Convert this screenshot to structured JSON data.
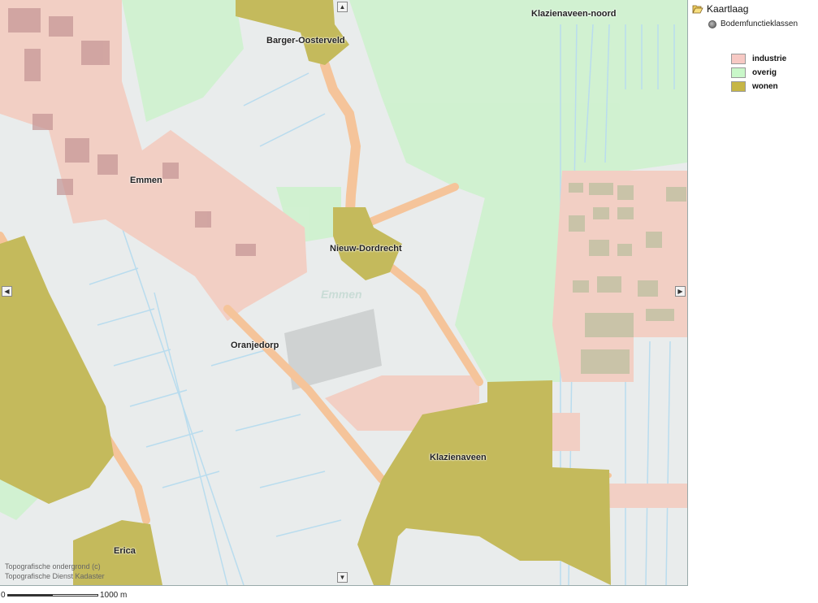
{
  "map": {
    "place_labels": [
      {
        "key": "klazienaveen-noord",
        "text": "Klazienaveen-noord"
      },
      {
        "key": "barger-oosterveld",
        "text": "Barger-Oosterveld"
      },
      {
        "key": "emmen",
        "text": "Emmen"
      },
      {
        "key": "nieuw-dordrecht",
        "text": "Nieuw-Dordrecht"
      },
      {
        "key": "oranjedorp",
        "text": "Oranjedorp"
      },
      {
        "key": "klazienaveen",
        "text": "Klazienaveen"
      },
      {
        "key": "erica",
        "text": "Erica"
      }
    ],
    "municipality_label": "Emmen",
    "copyright_line1": "Topografische ondergrond (c)",
    "copyright_line2": "Topografische Dienst Kadaster"
  },
  "navigation": {
    "pan_up": "▲",
    "pan_down": "▼",
    "pan_left": "◀",
    "pan_right": "▶"
  },
  "scalebar": {
    "start_label": "0",
    "end_label": "1000 m"
  },
  "legend": {
    "layer_title": "Kaartlaag",
    "layer_name": "Bodemfunctieklassen",
    "classes": [
      {
        "label": "industrie",
        "color": "#f7c9c4"
      },
      {
        "label": "overig",
        "color": "#c9f7c9"
      },
      {
        "label": "wonen",
        "color": "#c6b646"
      }
    ]
  },
  "colors": {
    "industrie": "#f2cfc4",
    "overig": "#ccf2cc",
    "wonen": "#c4ba5c",
    "road": "#f5c49a",
    "water": "#b9dcee",
    "background": "#e9ecec"
  }
}
